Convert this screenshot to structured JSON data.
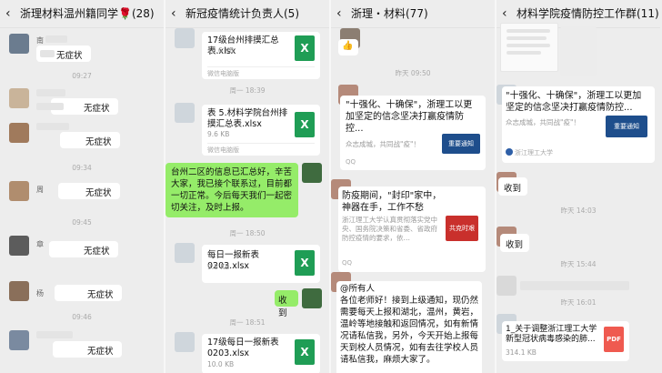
{
  "panel1": {
    "title": "浙理材料温州籍同学🌹(28)",
    "messages": [
      "无症状",
      "无症状",
      "无症状",
      "无症状",
      "无症状",
      "无症状",
      "无症状"
    ],
    "name_bits": [
      "南",
      "周",
      "章",
      "杨"
    ],
    "times": [
      "09:27",
      "09:34",
      "09:45",
      "09:46"
    ]
  },
  "panel2": {
    "title": "新冠疫情统计负责人(5)",
    "files": [
      {
        "name": "17级台州排摸汇总表.xlsx",
        "size": "10.6 KB",
        "src": "微信电脑版"
      },
      {
        "name": "表 5.材料学院台州排摸汇总表.xlsx",
        "size": "9.6 KB",
        "src": "微信电脑版"
      },
      {
        "name": "每日一报新表 0203.xlsx",
        "size": "9.8 KB"
      },
      {
        "name": "17级每日一报新表 0203.xlsx",
        "size": "10.0 KB"
      }
    ],
    "times": [
      "周一 18:39",
      "周一 18:50",
      "周一 18:51"
    ],
    "notice": "台州二区的信息已汇总好，辛苦大家，我已接个联系过，目前都一切正常。今后每天我们一起密切关注，及时上报。",
    "received": "收到"
  },
  "panel3": {
    "title": "浙理・材料(77)",
    "time1": "昨天 09:50",
    "card1_title": "\"十强化、十确保\"，浙理工以更加坚定的信念坚决打赢疫情防控...",
    "card1_sub": "众志成城，共同战\"疫\"！",
    "card1_src": "QQ",
    "thumb1_text": "重要通知",
    "card2_title": "防疫期间，\"封印\"家中，神器在手，工作不愁",
    "card2_sub": "浙江理工大学认真贯彻落实党中央、国务院决策和省委、省政府防控疫情的要求，依…",
    "card2_src": "QQ",
    "thumb2_text": "共克时艰",
    "announce": "@所有人\n各位老师好！接到上级通知，现仍然需要每天上报和湖北，温州，黄岩，温岭等地接触和返回情况，如有新情况请私信我，另外，今天开始上报每天到校人员情况，如有去往学校人员请私信我，麻烦大家了。"
  },
  "panel4": {
    "title": "材料学院疫情防控工作群(11)",
    "card_title": "\"十强化、十确保\"，浙理工以更加坚定的信念坚决打赢疫情防控...",
    "card_sub": "众志成城，共同战\"疫\"！",
    "card_src": "浙江理工大学",
    "thumb_text": "重要通知",
    "received1": "收到",
    "time1": "昨天 14:03",
    "received2": "收到",
    "time2": "昨天 15:44",
    "time3": "昨天 16:01",
    "file_name": "1_关于调整浙江理工大学新型冠状病毒感染的肺...",
    "file_size": "314.1 KB",
    "file_type": "PDF"
  }
}
